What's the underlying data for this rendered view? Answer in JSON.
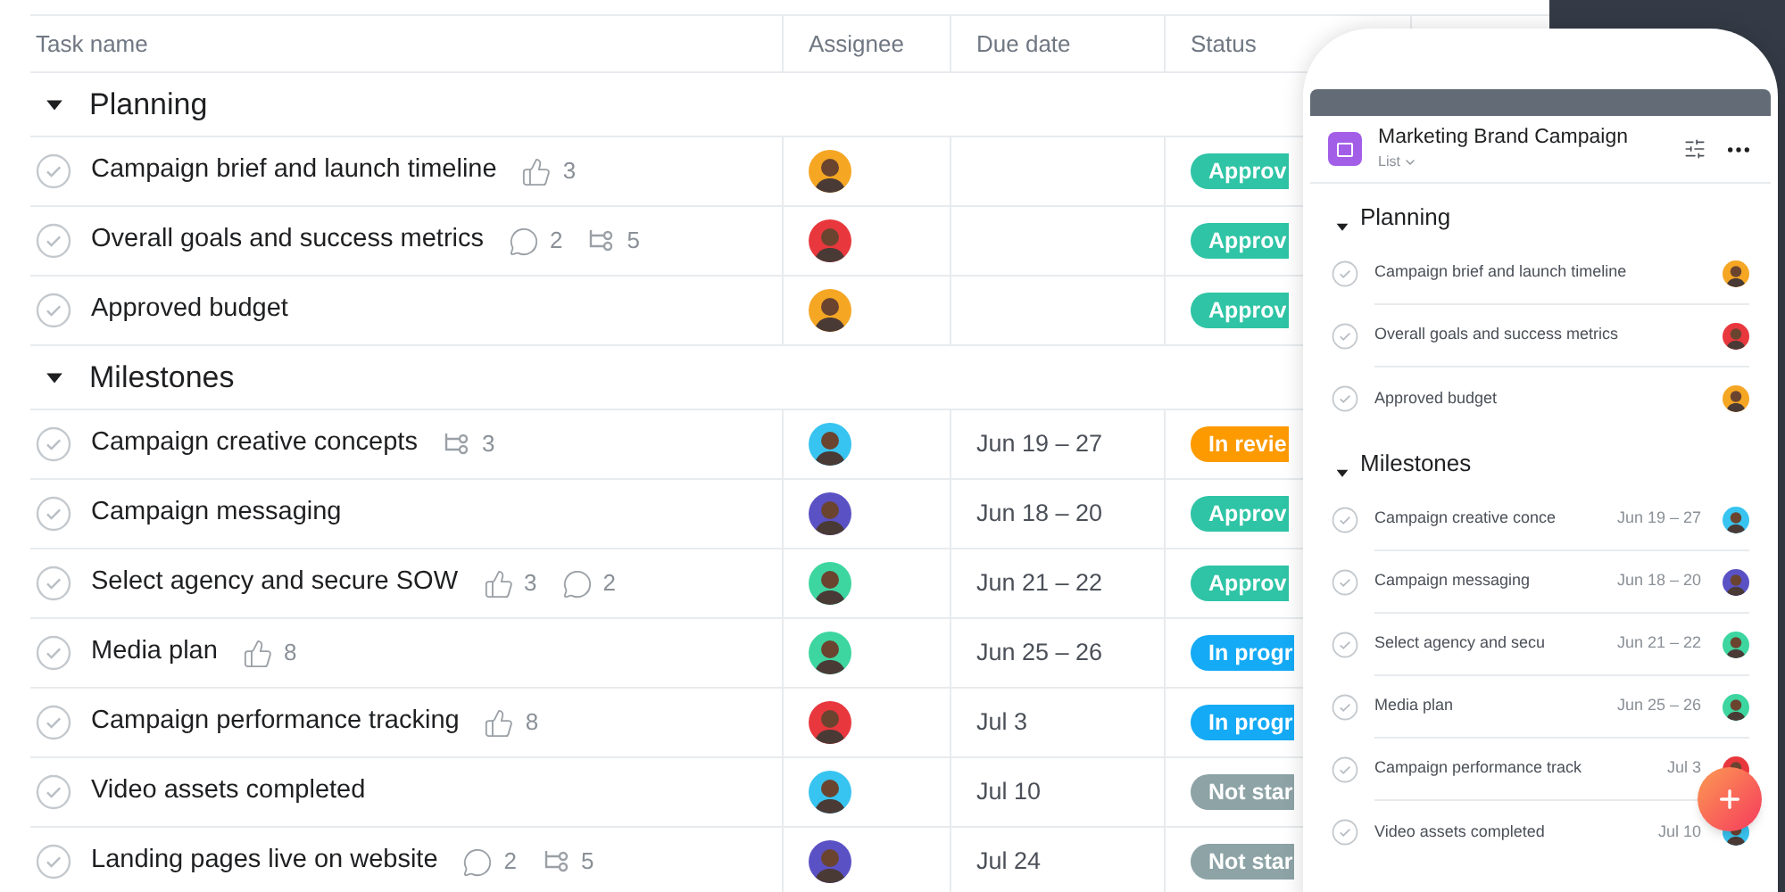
{
  "table": {
    "columns": [
      "Task name",
      "Assignee",
      "Due date",
      "Status"
    ],
    "sections": [
      {
        "name": "Planning",
        "expanded": true,
        "rows": [
          {
            "task": "Campaign brief and launch timeline",
            "completed": false,
            "metrics": [
              {
                "kind": "likes",
                "count": "3"
              }
            ],
            "avatar": {
              "color": "#f5a623"
            },
            "due": "",
            "status": {
              "label": "Approv",
              "color": "#2ec4a5"
            }
          },
          {
            "task": "Overall goals and success metrics",
            "completed": false,
            "metrics": [
              {
                "kind": "comments",
                "count": "2"
              },
              {
                "kind": "subtasks",
                "count": "5"
              }
            ],
            "avatar": {
              "color": "#e8383d"
            },
            "due": "",
            "status": {
              "label": "Approv",
              "color": "#2ec4a5"
            }
          },
          {
            "task": "Approved budget",
            "completed": false,
            "metrics": [],
            "avatar": {
              "color": "#f5a623"
            },
            "due": "",
            "status": {
              "label": "Approv",
              "color": "#2ec4a5"
            }
          }
        ]
      },
      {
        "name": "Milestones",
        "expanded": true,
        "rows": [
          {
            "task": "Campaign creative concepts",
            "completed": false,
            "metrics": [
              {
                "kind": "subtasks",
                "count": "3"
              }
            ],
            "avatar": {
              "color": "#38c4f0"
            },
            "due": "Jun 19 – 27",
            "status": {
              "label": "In revie",
              "color": "#fd9a00"
            }
          },
          {
            "task": "Campaign messaging",
            "completed": false,
            "metrics": [],
            "avatar": {
              "color": "#5a52c4"
            },
            "due": "Jun 18 – 20",
            "status": {
              "label": "Approv",
              "color": "#2ec4a5"
            }
          },
          {
            "task": "Select agency and secure SOW",
            "completed": false,
            "metrics": [
              {
                "kind": "likes",
                "count": "3"
              },
              {
                "kind": "comments",
                "count": "2"
              }
            ],
            "avatar": {
              "color": "#3dd6a0"
            },
            "due": "Jun 21 – 22",
            "status": {
              "label": "Approv",
              "color": "#2ec4a5"
            }
          },
          {
            "task": "Media plan",
            "completed": false,
            "metrics": [
              {
                "kind": "likes",
                "count": "8"
              }
            ],
            "avatar": {
              "color": "#3dd6a0"
            },
            "due": "Jun 25 – 26",
            "status": {
              "label": "In progr",
              "color": "#14aaf5"
            }
          },
          {
            "task": "Campaign performance tracking",
            "completed": false,
            "metrics": [
              {
                "kind": "likes",
                "count": "8"
              }
            ],
            "avatar": {
              "color": "#e8383d"
            },
            "due": "Jul 3",
            "status": {
              "label": "In progr",
              "color": "#14aaf5"
            }
          },
          {
            "task": "Video assets completed",
            "completed": false,
            "metrics": [],
            "avatar": {
              "color": "#38c4f0"
            },
            "due": "Jul 10",
            "status": {
              "label": "Not star",
              "color": "#8da3a6"
            }
          },
          {
            "task": "Landing pages live on website",
            "completed": false,
            "metrics": [
              {
                "kind": "comments",
                "count": "2"
              },
              {
                "kind": "subtasks",
                "count": "5"
              }
            ],
            "avatar": {
              "color": "#5a52c4"
            },
            "due": "Jul 24",
            "status": {
              "label": "Not star",
              "color": "#8da3a6"
            }
          }
        ]
      }
    ]
  },
  "phone": {
    "title": "Marketing Brand Campaign",
    "view": "List",
    "sections": [
      {
        "name": "Planning",
        "expanded": true,
        "rows": [
          {
            "task": "Campaign brief and launch timeline",
            "completed": false,
            "due": "",
            "avatar": {
              "color": "#f5a623"
            }
          },
          {
            "task": "Overall goals and success metrics",
            "completed": false,
            "due": "",
            "avatar": {
              "color": "#e8383d"
            }
          },
          {
            "task": "Approved budget",
            "completed": false,
            "due": "",
            "avatar": {
              "color": "#f5a623"
            }
          }
        ]
      },
      {
        "name": "Milestones",
        "expanded": true,
        "rows": [
          {
            "task": "Campaign creative conce",
            "completed": false,
            "due": "Jun 19 – 27",
            "avatar": {
              "color": "#38c4f0"
            }
          },
          {
            "task": "Campaign messaging",
            "completed": false,
            "due": "Jun 18 – 20",
            "avatar": {
              "color": "#5a52c4"
            }
          },
          {
            "task": "Select agency and secu",
            "completed": false,
            "due": "Jun 21 – 22",
            "avatar": {
              "color": "#3dd6a0"
            }
          },
          {
            "task": "Media plan",
            "completed": false,
            "due": "Jun 25 – 26",
            "avatar": {
              "color": "#3dd6a0"
            }
          },
          {
            "task": "Campaign performance track",
            "completed": false,
            "due": "Jul 3",
            "avatar": {
              "color": "#e8383d"
            }
          },
          {
            "task": "Video assets completed",
            "completed": false,
            "due": "Jul 10",
            "avatar": {
              "color": "#38c4f0"
            }
          }
        ]
      }
    ]
  }
}
